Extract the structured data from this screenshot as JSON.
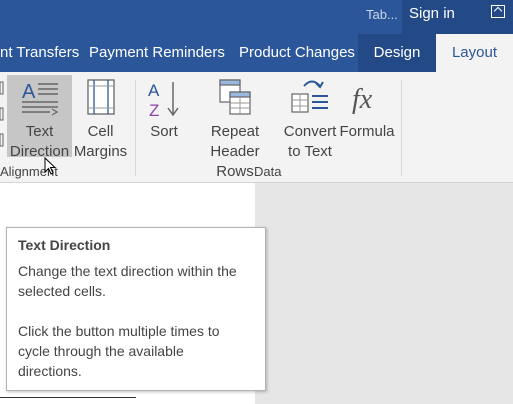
{
  "titlebar": {
    "tab_title": "Tab...",
    "signin": "Sign in",
    "restore_icon": "restore-window-icon"
  },
  "tabs": [
    {
      "label": "nt Transfers"
    },
    {
      "label": "Payment Reminders"
    },
    {
      "label": "Product Changes"
    },
    {
      "label": "Design"
    },
    {
      "label": "Layout"
    }
  ],
  "ribbon": {
    "alignment_group": {
      "label": "Alignment",
      "buttons": [
        {
          "line1": "Text",
          "line2": "Direction",
          "icon": "text-direction-icon",
          "pressed": true
        },
        {
          "line1": "Cell",
          "line2": "Margins",
          "icon": "cell-margins-icon"
        }
      ]
    },
    "data_group": {
      "label": "Data",
      "buttons": [
        {
          "line1": "Sort",
          "line2": "",
          "icon": "sort-az-icon"
        },
        {
          "line1": "Repeat",
          "line2": "Header Rows",
          "icon": "repeat-header-rows-icon"
        },
        {
          "line1": "Convert",
          "line2": "to Text",
          "icon": "convert-to-text-icon"
        },
        {
          "line1": "Formula",
          "line2": "",
          "icon": "formula-fx-icon"
        }
      ]
    }
  },
  "tooltip": {
    "title": "Text Direction",
    "line1": "Change the text direction within the",
    "line2": "selected cells.",
    "line3": "Click the button multiple times to",
    "line4": "cycle through the available",
    "line5": "directions."
  },
  "colors": {
    "titlebar_bg": "#2b579a",
    "context_tab_bg": "#234a86",
    "ribbon_bg": "#f3f3f3",
    "pressed_bg": "#c6c6c6"
  }
}
